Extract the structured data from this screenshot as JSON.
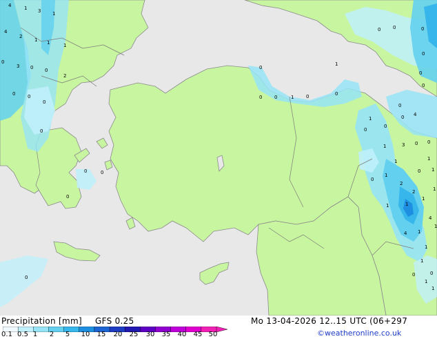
{
  "map": {
    "colors": {
      "sea": "#e8e8e8",
      "land": "#c8f5a0",
      "border": "#7a7a7a",
      "coast": "#8a8a8a"
    },
    "point_values": [
      "4",
      "1",
      "3",
      "1",
      "4",
      "2",
      "1",
      "1",
      "1",
      "0",
      "3",
      "0",
      "0",
      "2",
      "0",
      "0",
      "0",
      "0",
      "0",
      "0",
      "0",
      "0",
      "0",
      "0",
      "0",
      "1",
      "0",
      "0",
      "1",
      "0",
      "0",
      "0",
      "0",
      "0",
      "0",
      "0",
      "0",
      "1",
      "0",
      "4",
      "0",
      "1",
      "3",
      "0",
      "0",
      "0",
      "1",
      "1",
      "2",
      "0",
      "1",
      "1",
      "1",
      "1",
      "2",
      "1",
      "4",
      "1",
      "4",
      "1",
      "1",
      "0",
      "1",
      "1",
      "0",
      "1",
      "1"
    ]
  },
  "legend": {
    "title": "Precipitation [mm]",
    "model": "GFS 0.25",
    "valid": "Mo 13-04-2026 12..15 UTC (06+297",
    "credit": "©weatheronline.co.uk",
    "ticks": [
      "0.1",
      "0.5",
      "1",
      "2",
      "5",
      "10",
      "15",
      "20",
      "25",
      "30",
      "35",
      "40",
      "45",
      "50"
    ],
    "colors": [
      "#f0f9ff",
      "#bff0fb",
      "#96e4f6",
      "#64d0f0",
      "#36b6ea",
      "#1e8ee0",
      "#1c64d4",
      "#1c3cc4",
      "#2018b0",
      "#5e00c4",
      "#9000d0",
      "#c000d8",
      "#e000d0",
      "#f020b4"
    ]
  }
}
